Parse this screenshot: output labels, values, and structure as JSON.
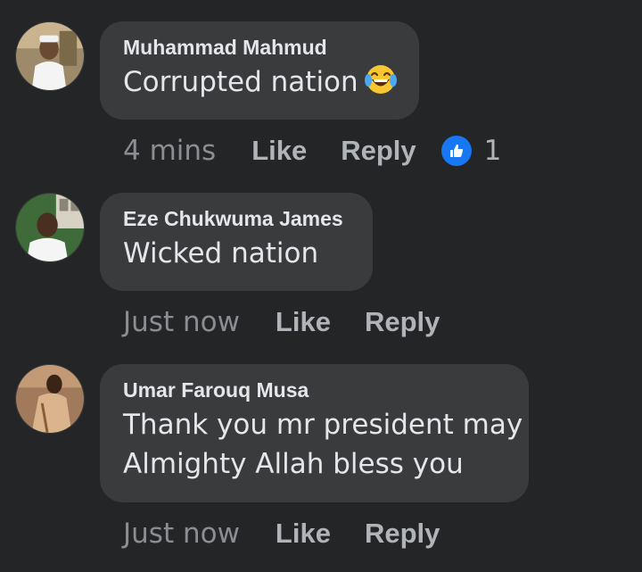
{
  "comments": [
    {
      "author": "Muhammad Mahmud",
      "text": "Corrupted nation",
      "emoji": "tears-of-joy-emoji",
      "time": "4 mins",
      "like_label": "Like",
      "reply_label": "Reply",
      "reaction_icon": "thumbs-up-icon",
      "reaction_count": "1"
    },
    {
      "author": "Eze Chukwuma James",
      "text": "Wicked nation",
      "time": "Just now",
      "like_label": "Like",
      "reply_label": "Reply"
    },
    {
      "author": "Umar Farouq Musa",
      "text_lines": [
        "Thank you mr president may",
        "Almighty Allah bless you"
      ],
      "time": "Just now",
      "like_label": "Like",
      "reply_label": "Reply"
    }
  ],
  "colors": {
    "background": "#242526",
    "bubble": "#3a3b3c",
    "primary_text": "#e4e6eb",
    "secondary_text": "#b0b3b8",
    "like_blue": "#1877f2"
  }
}
